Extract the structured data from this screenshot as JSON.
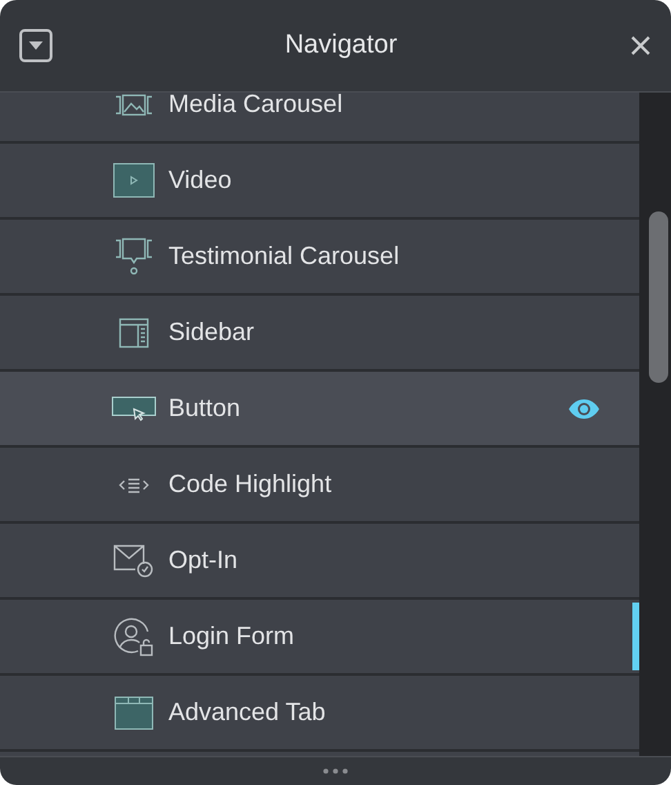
{
  "window": {
    "title": "Navigator"
  },
  "items": [
    {
      "label": "Media Carousel",
      "kind": "media-carousel",
      "hovered": false,
      "drop_target": false
    },
    {
      "label": "Video",
      "kind": "video",
      "hovered": false,
      "drop_target": false
    },
    {
      "label": "Testimonial Carousel",
      "kind": "testimonial",
      "hovered": false,
      "drop_target": false
    },
    {
      "label": "Sidebar",
      "kind": "sidebar",
      "hovered": false,
      "drop_target": false
    },
    {
      "label": "Button",
      "kind": "button",
      "hovered": true,
      "drop_target": false
    },
    {
      "label": "Code Highlight",
      "kind": "code",
      "hovered": false,
      "drop_target": false
    },
    {
      "label": "Opt-In",
      "kind": "optin",
      "hovered": false,
      "drop_target": false
    },
    {
      "label": "Login Form",
      "kind": "login",
      "hovered": false,
      "drop_target": true
    },
    {
      "label": "Advanced Tab",
      "kind": "tabs",
      "hovered": false,
      "drop_target": false
    }
  ]
}
